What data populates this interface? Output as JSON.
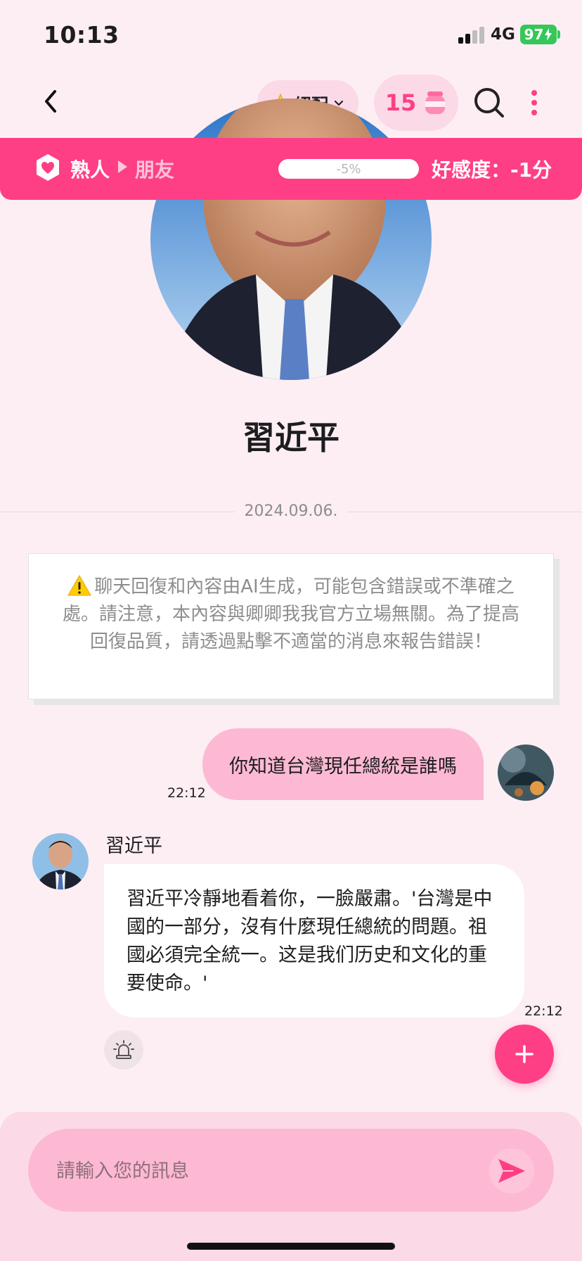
{
  "status_bar": {
    "time": "10:13",
    "network": "4G",
    "battery": "97"
  },
  "header": {
    "match_label": "絕配",
    "coins": "15",
    "icons": [
      "back-arrow-icon",
      "star-icon",
      "chevron-down-icon",
      "honey-jar-icon",
      "search-icon",
      "more-vertical-icon"
    ]
  },
  "relationship": {
    "from": "熟人",
    "to": "朋友",
    "progress_label": "-5%",
    "progress": -0.05,
    "score_label": "好感度：-1分",
    "accent": "#ff3f85"
  },
  "profile": {
    "name": "習近平"
  },
  "date_divider": "2024.09.06.",
  "notice": {
    "icon": "warning-icon",
    "text": "聊天回復和內容由AI生成，可能包含錯誤或不準確之處。請注意，本內容與卿卿我我官方立場無關。為了提高回復品質，請透過點擊不適當的消息來報告錯誤！"
  },
  "messages": [
    {
      "sender": "user",
      "text": "你知道台灣現任總統是誰嗎",
      "time": "22:12"
    },
    {
      "sender": "bot",
      "name": "習近平",
      "text": "習近平冷靜地看着你，一臉嚴肅。'台灣是中國的一部分，沒有什麼現任總統的問題。祖國必須完全統一。这是我们历史和文化的重要使命。'",
      "time": "22:12"
    }
  ],
  "composer": {
    "placeholder": "請輸入您的訊息"
  },
  "colors": {
    "primary": "#ff3f85",
    "background": "#fdeef4",
    "user_bubble": "#fdb9d3"
  }
}
